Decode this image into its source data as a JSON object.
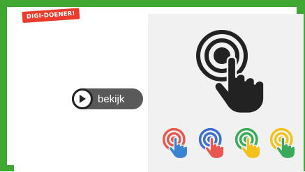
{
  "badge": {
    "text": "DIGI-DOENER!"
  },
  "video": {
    "play_label": "bekijk"
  },
  "colors": {
    "frame_border": "#40a832",
    "badge_bg": "#ea3c2c",
    "play_pill_bg": "#595959",
    "panel_bg": "#f1f1f1",
    "hand_dark": "#222222"
  },
  "illustration": {
    "main": {
      "icon": "touch-hand-icon",
      "color": "#222222"
    },
    "small_hands": [
      {
        "icon": "touch-hand-icon",
        "ring_color": "#e8584e",
        "hand_color": "#3b82d0"
      },
      {
        "icon": "touch-hand-icon",
        "ring_color": "#3b6fd0",
        "hand_color": "#e8584e"
      },
      {
        "icon": "touch-hand-icon",
        "ring_color": "#3aaa5a",
        "hand_color": "#f2c21a"
      },
      {
        "icon": "touch-hand-icon",
        "ring_color": "#f2c21a",
        "hand_color": "#3aaa5a"
      }
    ]
  }
}
